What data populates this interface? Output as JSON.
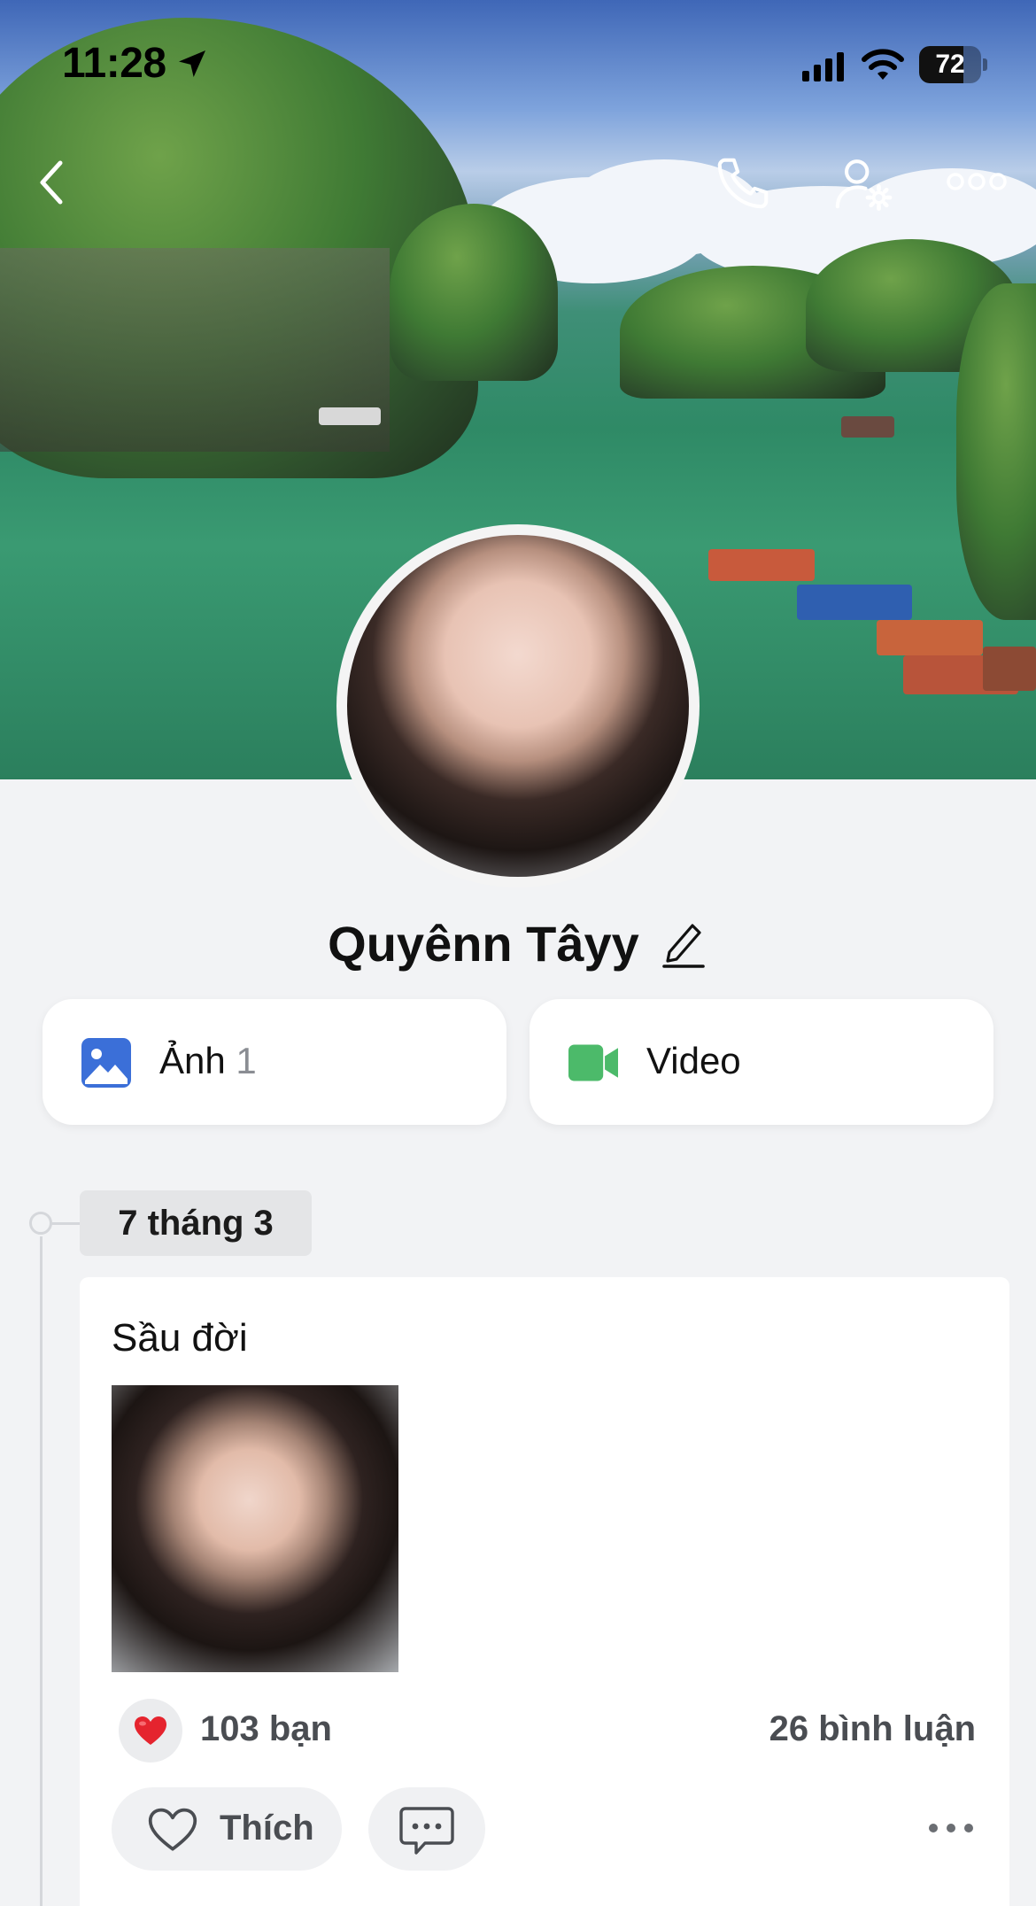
{
  "status_bar": {
    "time": "11:28",
    "battery_percent": "72",
    "battery_level": 0.72
  },
  "header": {
    "icons": [
      "back-icon",
      "phone-icon",
      "user-settings-icon",
      "more-icon"
    ]
  },
  "profile": {
    "name": "Quyênn Tâyy"
  },
  "media": {
    "photos_label": "Ảnh",
    "photos_count": "1",
    "video_label": "Video"
  },
  "timeline": {
    "date": "7 tháng 3"
  },
  "post": {
    "text": "Sầu đời",
    "reaction_icon": "heart-emoji",
    "reactions": "103 bạn",
    "comments": "26 bình luận",
    "like_label": "Thích"
  },
  "colors": {
    "photo_icon": "#3b6fd8",
    "video_icon": "#4cba6a",
    "heart": "#e5242e"
  }
}
